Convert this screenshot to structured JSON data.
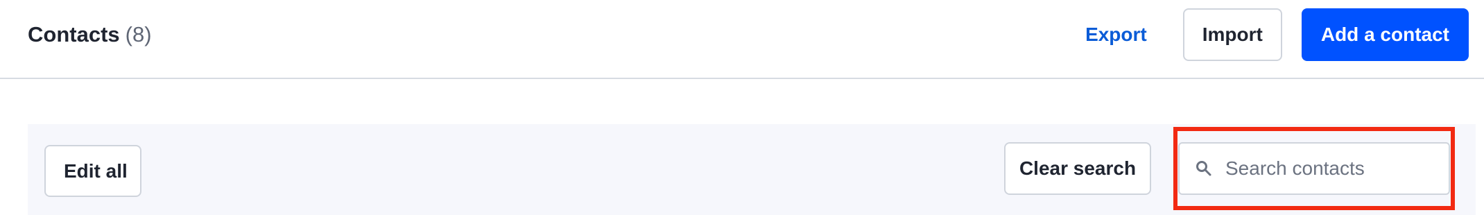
{
  "page": {
    "title": "Contacts",
    "count": "(8)"
  },
  "header": {
    "export_label": "Export",
    "import_label": "Import",
    "add_contact_label": "Add a contact"
  },
  "toolbar": {
    "edit_all_label": "Edit all",
    "clear_search_label": "Clear search",
    "search_placeholder": "Search contacts",
    "search_value": ""
  },
  "icons": {
    "search": "search-icon"
  },
  "colors": {
    "primary": "#0052ff",
    "link": "#0b5cd7",
    "highlight": "#f22a12",
    "panel_background": "#f6f7fc",
    "border": "#cfd4dc"
  }
}
